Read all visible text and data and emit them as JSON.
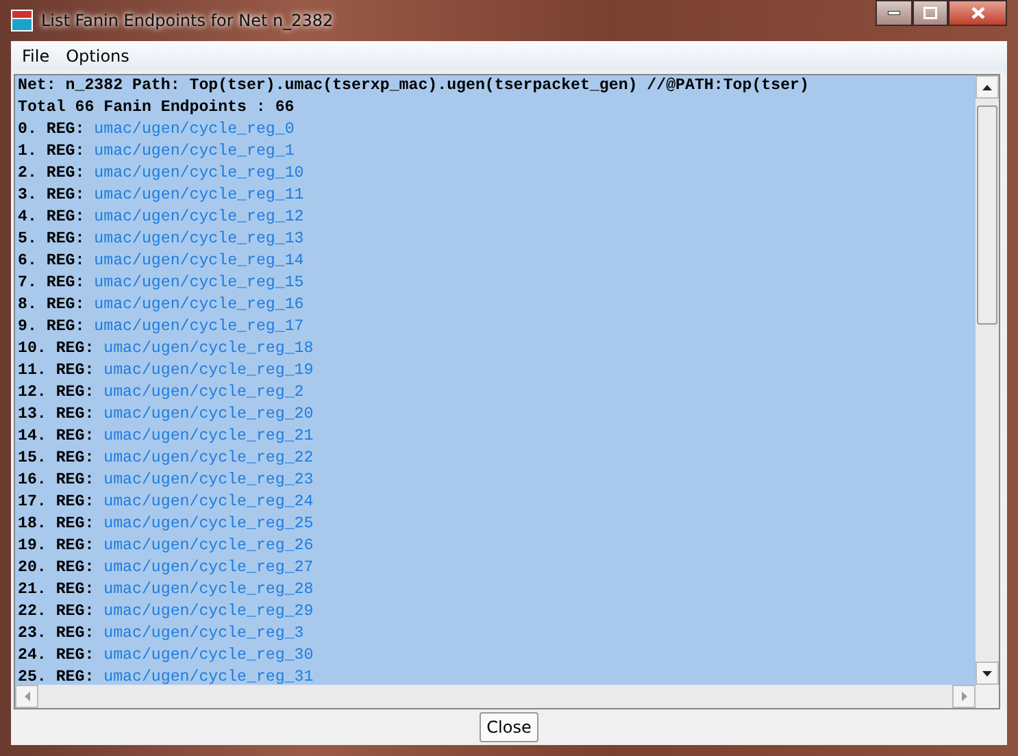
{
  "window": {
    "title": "List Fanin Endpoints for Net n_2382"
  },
  "menu": [
    "File",
    "Options"
  ],
  "text_area": {
    "selected": true,
    "header_lines": [
      "Net: n_2382 Path: Top(tser).umac(tserxp_mac).ugen(tserpacket_gen) //@PATH:Top(tser)",
      "Total 66 Fanin Endpoints : 66"
    ],
    "endpoints": [
      {
        "label": "0. REG:",
        "path": "umac/ugen/cycle_reg_0"
      },
      {
        "label": "1. REG:",
        "path": "umac/ugen/cycle_reg_1"
      },
      {
        "label": "2. REG:",
        "path": "umac/ugen/cycle_reg_10"
      },
      {
        "label": "3. REG:",
        "path": "umac/ugen/cycle_reg_11"
      },
      {
        "label": "4. REG:",
        "path": "umac/ugen/cycle_reg_12"
      },
      {
        "label": "5. REG:",
        "path": "umac/ugen/cycle_reg_13"
      },
      {
        "label": "6. REG:",
        "path": "umac/ugen/cycle_reg_14"
      },
      {
        "label": "7. REG:",
        "path": "umac/ugen/cycle_reg_15"
      },
      {
        "label": "8. REG:",
        "path": "umac/ugen/cycle_reg_16"
      },
      {
        "label": "9. REG:",
        "path": "umac/ugen/cycle_reg_17"
      },
      {
        "label": "10. REG:",
        "path": "umac/ugen/cycle_reg_18"
      },
      {
        "label": "11. REG:",
        "path": "umac/ugen/cycle_reg_19"
      },
      {
        "label": "12. REG:",
        "path": "umac/ugen/cycle_reg_2"
      },
      {
        "label": "13. REG:",
        "path": "umac/ugen/cycle_reg_20"
      },
      {
        "label": "14. REG:",
        "path": "umac/ugen/cycle_reg_21"
      },
      {
        "label": "15. REG:",
        "path": "umac/ugen/cycle_reg_22"
      },
      {
        "label": "16. REG:",
        "path": "umac/ugen/cycle_reg_23"
      },
      {
        "label": "17. REG:",
        "path": "umac/ugen/cycle_reg_24"
      },
      {
        "label": "18. REG:",
        "path": "umac/ugen/cycle_reg_25"
      },
      {
        "label": "19. REG:",
        "path": "umac/ugen/cycle_reg_26"
      },
      {
        "label": "20. REG:",
        "path": "umac/ugen/cycle_reg_27"
      },
      {
        "label": "21. REG:",
        "path": "umac/ugen/cycle_reg_28"
      },
      {
        "label": "22. REG:",
        "path": "umac/ugen/cycle_reg_29"
      },
      {
        "label": "23. REG:",
        "path": "umac/ugen/cycle_reg_3"
      },
      {
        "label": "24. REG:",
        "path": "umac/ugen/cycle_reg_30"
      },
      {
        "label": "25. REG:",
        "path": "umac/ugen/cycle_reg_31"
      }
    ]
  },
  "buttons": [
    "Close"
  ]
}
